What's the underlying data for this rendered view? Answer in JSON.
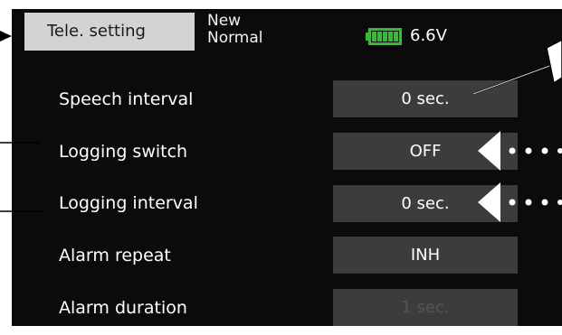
{
  "header": {
    "title": "Tele. setting",
    "model_line1": "New",
    "model_line2": "Normal",
    "battery_voltage": "6.6V",
    "battery_icon": "battery-full-icon",
    "battery_color": "#2fbf2f"
  },
  "rows": [
    {
      "label": "Speech interval",
      "value": "0 sec."
    },
    {
      "label": "Logging switch",
      "value": "OFF"
    },
    {
      "label": "Logging interval",
      "value": "0 sec."
    },
    {
      "label": "Alarm repeat",
      "value": "INH"
    },
    {
      "label": "Alarm duration",
      "value": "1 sec.",
      "disabled": true
    }
  ],
  "colors": {
    "screen_bg": "#0b0b0b",
    "value_box": "#3c3c3c",
    "title_tab": "#d3d3d3"
  }
}
